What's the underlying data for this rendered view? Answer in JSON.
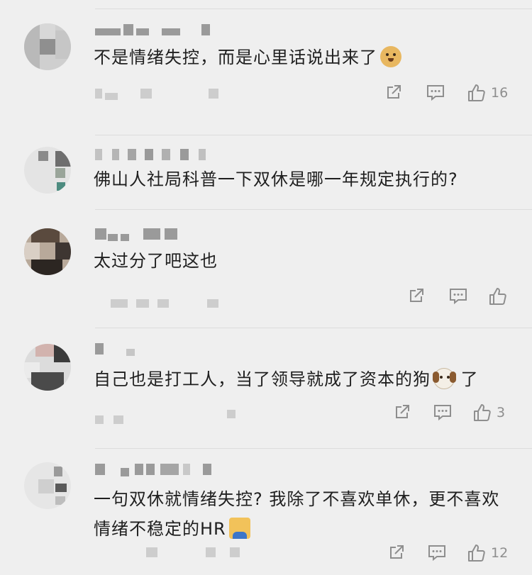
{
  "comments": [
    {
      "text": "不是情绪失控，而是心里话说出来了",
      "emoji": "doge-emoji",
      "likes": "16"
    },
    {
      "text": "佛山人社局科普一下双休是哪一年规定执行的?",
      "emoji": "",
      "likes": ""
    },
    {
      "text": "太过分了吧这也",
      "emoji": "",
      "likes": ""
    },
    {
      "text": "自己也是打工人，当了领导就成了资本的狗",
      "emoji": "dog-face-emoji",
      "text_after": "了",
      "likes": "3"
    },
    {
      "text_lines": [
        "一句双休就情绪失控? 我除了不喜欢单休，更不喜欢",
        "情绪不稳定的HR"
      ],
      "emoji": "person-shrugging-emoji",
      "likes": "12"
    }
  ],
  "icons": {
    "share": "share-icon",
    "reply": "comment-icon",
    "like": "thumbs-up-icon"
  },
  "colors": {
    "background": "#efefef",
    "icon": "#8e8e8e",
    "text": "#1f1f1f"
  }
}
